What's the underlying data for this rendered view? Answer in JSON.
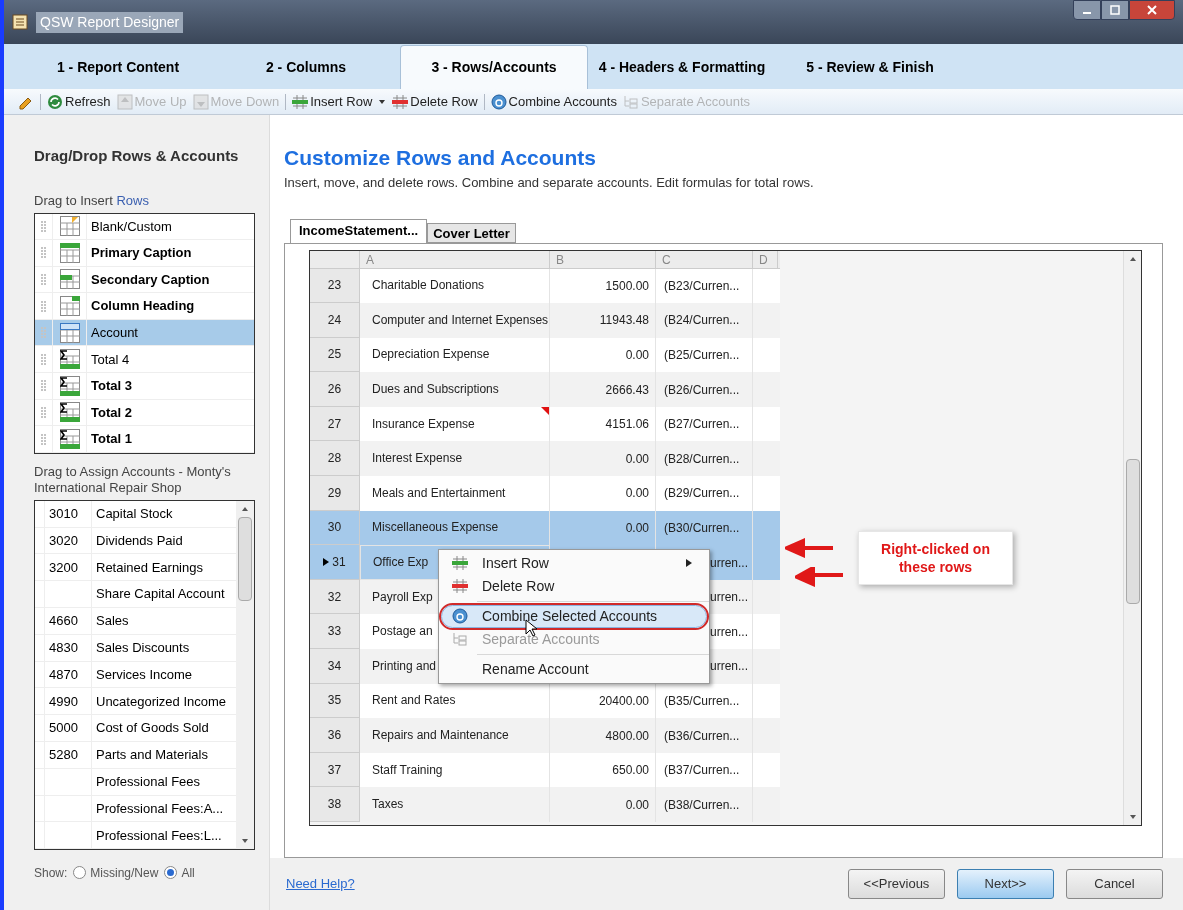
{
  "window": {
    "title": "QSW Report Designer"
  },
  "wizard_tabs": [
    {
      "label": "1 - Report Content",
      "selected": false
    },
    {
      "label": "2 - Columns",
      "selected": false
    },
    {
      "label": "3 - Rows/Accounts",
      "selected": true
    },
    {
      "label": "4 - Headers & Formatting",
      "selected": false
    },
    {
      "label": "5 - Review & Finish",
      "selected": false
    }
  ],
  "toolbar": [
    {
      "kind": "edit",
      "disabled": false
    },
    {
      "kind": "refresh",
      "label": "Refresh",
      "disabled": false
    },
    {
      "kind": "up",
      "label": "Move Up",
      "disabled": true
    },
    {
      "kind": "down",
      "label": "Move Down",
      "disabled": true
    },
    {
      "kind": "insert",
      "label": "Insert Row",
      "disabled": false
    },
    {
      "kind": "delete",
      "label": "Delete Row",
      "disabled": false
    },
    {
      "kind": "combine",
      "label": "Combine Accounts",
      "disabled": false
    },
    {
      "kind": "separate",
      "label": "Separate Accounts",
      "disabled": true
    }
  ],
  "sidebar": {
    "title": "Drag/Drop Rows & Accounts",
    "insert_label": "Drag to Insert ",
    "insert_label_link": "Rows",
    "row_types": [
      {
        "kind": "custom",
        "label": "Blank/Custom",
        "bold": false,
        "selected": false
      },
      {
        "kind": "primary",
        "label": "Primary Caption",
        "bold": true,
        "selected": false
      },
      {
        "kind": "secondary",
        "label": "Secondary Caption",
        "bold": true,
        "selected": false
      },
      {
        "kind": "heading",
        "label": "Column Heading",
        "bold": true,
        "selected": false
      },
      {
        "kind": "account",
        "label": "Account",
        "bold": false,
        "selected": true
      },
      {
        "kind": "total",
        "label": "Total 4",
        "bold": false,
        "selected": false
      },
      {
        "kind": "total",
        "label": "Total 3",
        "bold": true,
        "selected": false
      },
      {
        "kind": "total",
        "label": "Total 2",
        "bold": true,
        "selected": false
      },
      {
        "kind": "total",
        "label": "Total 1",
        "bold": true,
        "selected": false
      }
    ],
    "accounts_label": "Drag to Assign Accounts - Monty's International Repair Shop",
    "accounts": [
      {
        "number": "3010",
        "name": "Capital Stock"
      },
      {
        "number": "3020",
        "name": "Dividends Paid"
      },
      {
        "number": "3200",
        "name": "Retained Earnings"
      },
      {
        "name": "Share Capital Account"
      },
      {
        "number": "4660",
        "name": "Sales"
      },
      {
        "number": "4830",
        "name": "Sales Discounts"
      },
      {
        "number": "4870",
        "name": "Services Income"
      },
      {
        "number": "4990",
        "name": "Uncategorized Income"
      },
      {
        "number": "5000",
        "name": "Cost of Goods Sold"
      },
      {
        "number": "5280",
        "name": "Parts and Materials"
      },
      {
        "name": "Professional Fees"
      },
      {
        "name": "Professional Fees:A..."
      },
      {
        "name": "Professional Fees:L..."
      }
    ],
    "show_label": "Show:",
    "show_options": [
      {
        "label": "Missing/New",
        "selected": false
      },
      {
        "label": "All",
        "selected": true
      }
    ]
  },
  "main": {
    "title": "Customize Rows and Accounts",
    "subtitle": "Insert, move, and delete rows. Combine and separate accounts. Edit formulas for total rows.",
    "sheet_tabs": [
      {
        "label": "IncomeStatement...",
        "selected": true
      },
      {
        "label": "Cover Letter",
        "selected": false
      }
    ],
    "columns": [
      "A",
      "B",
      "C",
      "D"
    ],
    "rows": [
      {
        "number": "23",
        "a": "Charitable Donations",
        "b": "1500.00",
        "c": "(B23/Curren...",
        "selected": false,
        "current": false,
        "note": false,
        "kind": "full"
      },
      {
        "number": "24",
        "a": "Computer and Internet Expenses",
        "b": "11943.48",
        "c": "(B24/Curren...",
        "selected": false,
        "current": false,
        "note": false,
        "kind": "full"
      },
      {
        "number": "25",
        "a": "Depreciation Expense",
        "b": "0.00",
        "c": "(B25/Curren...",
        "selected": false,
        "current": false,
        "note": false,
        "kind": "full"
      },
      {
        "number": "26",
        "a": "Dues and Subscriptions",
        "b": "2666.43",
        "c": "(B26/Curren...",
        "selected": false,
        "current": false,
        "note": false,
        "kind": "full"
      },
      {
        "number": "27",
        "a": "Insurance Expense",
        "b": "4151.06",
        "c": "(B27/Curren...",
        "selected": false,
        "current": false,
        "note": true,
        "kind": "full"
      },
      {
        "number": "28",
        "a": "Interest Expense",
        "b": "0.00",
        "c": "(B28/Curren...",
        "selected": false,
        "current": false,
        "note": false,
        "kind": "full"
      },
      {
        "number": "29",
        "a": "Meals and Entertainment",
        "b": "0.00",
        "c": "(B29/Curren...",
        "selected": false,
        "current": false,
        "note": false,
        "kind": "full"
      },
      {
        "number": "30",
        "a": "Miscellaneous Expense",
        "b": "0.00",
        "c": "(B30/Curren...",
        "selected": true,
        "current": false,
        "note": false,
        "kind": "full"
      },
      {
        "number": "31",
        "a": "Office Exp",
        "c": "urren...",
        "selected": true,
        "current": true,
        "note": false,
        "kind": "partial"
      },
      {
        "number": "32",
        "a": "Payroll Exp",
        "c": "urren...",
        "selected": false,
        "current": false,
        "note": false,
        "kind": "partial"
      },
      {
        "number": "33",
        "a": "Postage an",
        "c": "urren...",
        "selected": false,
        "current": false,
        "note": false,
        "kind": "partial"
      },
      {
        "number": "34",
        "a": "Printing and",
        "c": "urren...",
        "selected": false,
        "current": false,
        "note": false,
        "kind": "partial"
      },
      {
        "number": "35",
        "a": "Rent and Rates",
        "b": "20400.00",
        "c": "(B35/Curren...",
        "selected": false,
        "current": false,
        "note": false,
        "kind": "full"
      },
      {
        "number": "36",
        "a": "Repairs and Maintenance",
        "b": "4800.00",
        "c": "(B36/Curren...",
        "selected": false,
        "current": false,
        "note": false,
        "kind": "full"
      },
      {
        "number": "37",
        "a": "Staff Training",
        "b": "650.00",
        "c": "(B37/Curren...",
        "selected": false,
        "current": false,
        "note": false,
        "kind": "full"
      },
      {
        "number": "38",
        "a": "Taxes",
        "b": "0.00",
        "c": "(B38/Curren...",
        "selected": false,
        "current": false,
        "note": false,
        "kind": "full"
      }
    ],
    "context_menu": [
      {
        "kind": "insert",
        "label": "Insert Row",
        "submenu": true,
        "disabled": false,
        "highlighted": false
      },
      {
        "kind": "delete",
        "label": "Delete Row",
        "submenu": false,
        "disabled": false,
        "highlighted": false
      },
      {
        "kind": "separator"
      },
      {
        "kind": "combine",
        "label": "Combine Selected Accounts",
        "submenu": false,
        "disabled": false,
        "highlighted": true
      },
      {
        "kind": "separate",
        "label": "Separate Accounts",
        "submenu": false,
        "disabled": true,
        "highlighted": false
      },
      {
        "kind": "separator"
      },
      {
        "kind": "rename",
        "label": "Rename Account",
        "submenu": false,
        "disabled": false,
        "highlighted": false
      }
    ],
    "callout": "Right-clicked on these rows"
  },
  "footer": {
    "help_link": "Need Help?",
    "buttons": [
      {
        "label": "<<Previous",
        "primary": false
      },
      {
        "label": "Next>>",
        "primary": true
      },
      {
        "label": "Cancel",
        "primary": false
      }
    ]
  }
}
